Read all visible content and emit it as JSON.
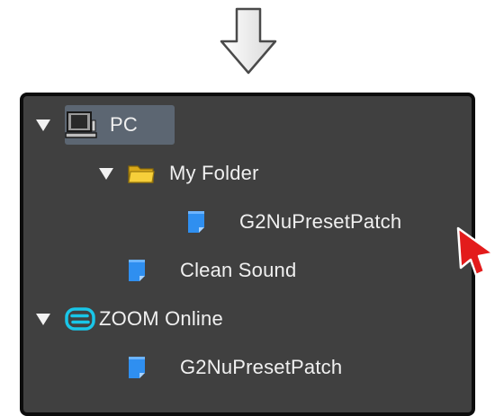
{
  "tree": {
    "pc": {
      "label": "PC",
      "expanded": true
    },
    "my_folder": {
      "label": "My Folder",
      "expanded": true
    },
    "folder_patch": {
      "label": "G2NuPresetPatch"
    },
    "clean_sound": {
      "label": "Clean Sound"
    },
    "zoom_online": {
      "label": "ZOOM Online",
      "expanded": true
    },
    "online_patch": {
      "label": "G2NuPresetPatch"
    }
  },
  "icons": {
    "down_arrow": "down-arrow-icon",
    "computer": "computer-icon",
    "folder": "folder-icon",
    "document": "document-icon",
    "zoom_logo": "zoom-logo-icon",
    "cursor": "cursor-arrow-icon"
  },
  "colors": {
    "panel_bg": "#404040",
    "selection": "#5c6672",
    "text": "#f0f0f0",
    "document_blue": "#2f8ff0",
    "folder_yellow": "#f2c227",
    "zoom_cyan": "#19c6e8",
    "cursor_red": "#e31b1b"
  }
}
